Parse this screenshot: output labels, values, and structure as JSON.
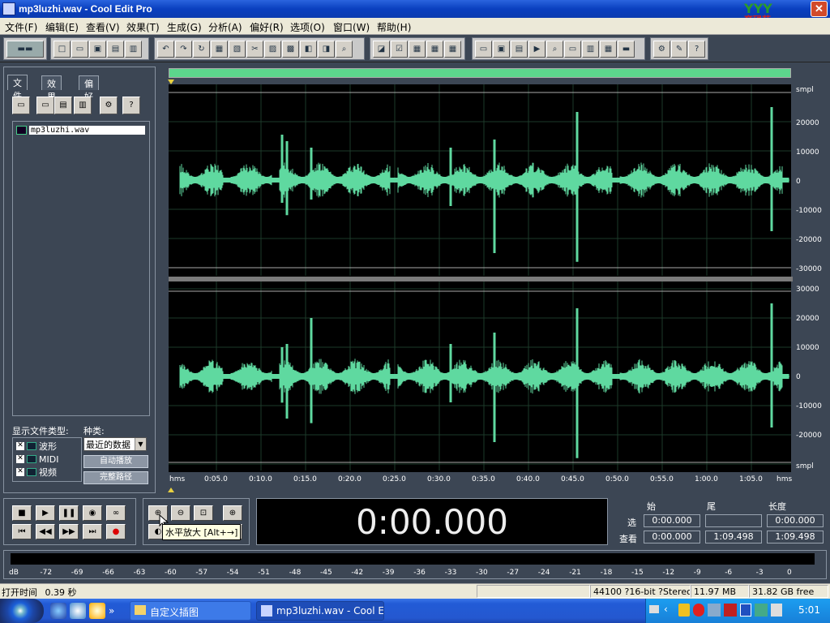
{
  "window": {
    "title": "mp3luzhi.wav - Cool Edit Pro",
    "close_glyph": "✕",
    "logo_text": "育碌苑"
  },
  "menu": [
    "文件(F)",
    "编辑(E)",
    "查看(V)",
    "效果(T)",
    "生成(G)",
    "分析(A)",
    "偏好(R)",
    "选项(O)",
    "窗口(W)",
    "帮助(H)"
  ],
  "left_panel": {
    "tabs": [
      "文件",
      "效果",
      "偏好"
    ],
    "files": [
      {
        "name": "mp3luzhi.wav"
      }
    ],
    "filetype_label": "显示文件类型:",
    "filetypes": [
      {
        "label": "波形",
        "checked": "✕"
      },
      {
        "label": "MIDI",
        "checked": "✕"
      },
      {
        "label": "视频",
        "checked": "✕"
      }
    ],
    "kind_label": "种类:",
    "kind_value": "最近的数据",
    "autoplay_btn": "自动播放",
    "fullpath_btn": "完整路径"
  },
  "waveform": {
    "unit": "smpl",
    "top_scale": [
      "20000",
      "10000",
      "0",
      "-10000",
      "-20000",
      "-30000"
    ],
    "bottom_scale": [
      "30000",
      "20000",
      "10000",
      "0",
      "-10000",
      "-20000"
    ],
    "bottom_unit": "smpl",
    "wave_color": "#5fd9a0",
    "timeline": [
      "hms",
      "0:05.0",
      "0:10.0",
      "0:15.0",
      "0:20.0",
      "0:25.0",
      "0:30.0",
      "0:35.0",
      "0:40.0",
      "0:45.0",
      "0:50.0",
      "0:55.0",
      "1:00.0",
      "1:05.0",
      "hms"
    ]
  },
  "zoom": {
    "tooltip": "水平放大 [Alt+→]"
  },
  "time_display": "0:00.000",
  "selection": {
    "headers": [
      "始",
      "尾",
      "长度"
    ],
    "sel_label": "选",
    "view_label": "查看",
    "sel_begin": "0:00.000",
    "sel_end": "",
    "sel_length": "0:00.000",
    "view_begin": "0:00.000",
    "view_end": "1:09.498",
    "view_length": "1:09.498"
  },
  "levels": [
    "dB",
    "-72",
    "-69",
    "-66",
    "-63",
    "-60",
    "-57",
    "-54",
    "-51",
    "-48",
    "-45",
    "-42",
    "-39",
    "-36",
    "-33",
    "-30",
    "-27",
    "-24",
    "-21",
    "-18",
    "-15",
    "-12",
    "-9",
    "-6",
    "-3",
    "0"
  ],
  "status": {
    "open_time_label": "打开时间",
    "open_time": "0.39 秒",
    "format": "44100 ?16-bit ?Stereo",
    "size": "11.97 MB",
    "free": "31.82 GB free"
  },
  "taskbar": {
    "tasks": [
      {
        "label": "自定义插图"
      },
      {
        "label": "mp3luzhi.wav - Cool E..."
      }
    ],
    "clock": "5:01",
    "chevron": "»",
    "tray_chevron": "‹"
  }
}
